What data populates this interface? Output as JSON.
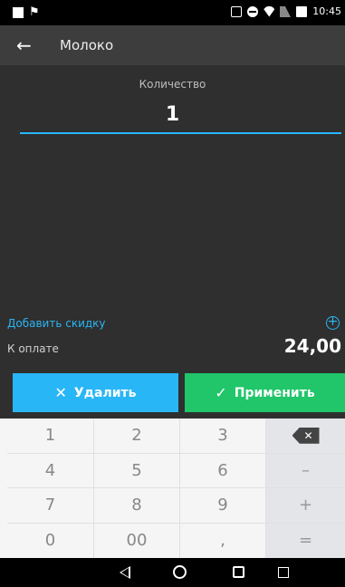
{
  "status_bar": {
    "time": "10:45"
  },
  "app_bar": {
    "title": "Молоко"
  },
  "quantity": {
    "label": "Количество",
    "value": "1"
  },
  "discount": {
    "link_label": "Добавить скидку"
  },
  "payment": {
    "label": "К оплате",
    "amount": "24,00"
  },
  "actions": {
    "delete_label": "Удалить",
    "apply_label": "Применить"
  },
  "keypad": {
    "keys": [
      "1",
      "2",
      "3",
      "4",
      "5",
      "6",
      "–",
      "7",
      "8",
      "9",
      "+",
      "0",
      "00",
      ",",
      "="
    ]
  },
  "colors": {
    "accent": "#29b6f6",
    "apply": "#21c56a",
    "background": "#2f2f2f",
    "app_bar": "#3d3d3d"
  }
}
